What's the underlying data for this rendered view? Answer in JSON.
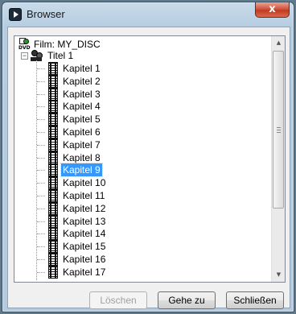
{
  "window": {
    "title": "Browser",
    "close_label": "x"
  },
  "tree": {
    "root": {
      "label": "Film: MY_DISC",
      "icon_text": "DVD"
    },
    "title_node": {
      "label": "Titel 1"
    },
    "chapters": [
      "Kapitel 1",
      "Kapitel 2",
      "Kapitel 3",
      "Kapitel 4",
      "Kapitel 5",
      "Kapitel 6",
      "Kapitel 7",
      "Kapitel 8",
      "Kapitel 9",
      "Kapitel 10",
      "Kapitel 11",
      "Kapitel 12",
      "Kapitel 13",
      "Kapitel 14",
      "Kapitel 15",
      "Kapitel 16",
      "Kapitel 17"
    ],
    "selected_chapter": "Kapitel 9"
  },
  "buttons": {
    "delete": "Löschen",
    "goto": "Gehe zu",
    "close": "Schließen"
  }
}
